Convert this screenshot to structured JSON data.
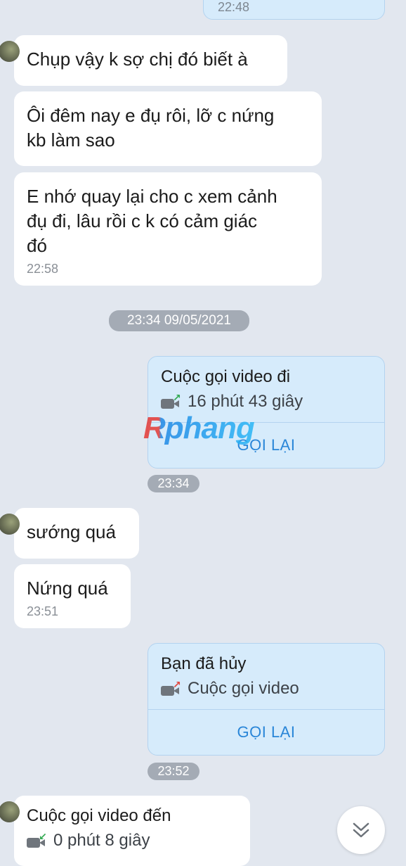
{
  "messages": {
    "top_out_time": "22:48",
    "in1": "Chụp vậy k sợ chị đó biết à",
    "in2_line1": "Ôi đêm nay e đụ rôi,  lỡ c nứng",
    "in2_line2": "kb làm sao",
    "in3_line1": "E nhớ quay lại cho c xem cảnh",
    "in3_line2": "đụ đi, lâu rồi c k có cảm giác",
    "in3_line3": "đó",
    "in3_time": "22:58",
    "date_separator": "23:34 09/05/2021",
    "call1_title": "Cuộc gọi video đi",
    "call1_sub": "16 phút 43 giây",
    "call1_button": "GỌI LẠI",
    "call1_time": "23:34",
    "in4": "sướng quá",
    "in5": "Nứng quá",
    "in5_time": "23:51",
    "call2_title": "Bạn đã hủy",
    "call2_sub": "Cuộc gọi video",
    "call2_button": "GỌI LẠI",
    "call2_time": "23:52",
    "call3_title": "Cuộc gọi video đến",
    "call3_sub": "0 phút 8 giây"
  },
  "watermark": "Rphang",
  "icons": {
    "video_call": "video-camera-icon",
    "scroll_down": "chevron-double-down-icon"
  },
  "colors": {
    "background": "#e2e7ef",
    "outgoing_bubble": "#d6ebfb",
    "action_blue": "#2a86d8",
    "outgoing_arrow": "#2fa84f",
    "cancelled_arrow": "#e0463c"
  }
}
